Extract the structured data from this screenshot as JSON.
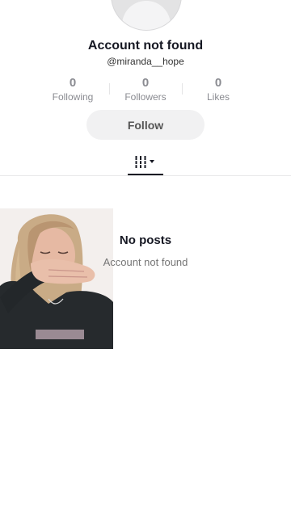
{
  "profile": {
    "name": "Account not found",
    "handle": "@miranda__hope"
  },
  "stats": [
    {
      "value": "0",
      "label": "Following"
    },
    {
      "value": "0",
      "label": "Followers"
    },
    {
      "value": "0",
      "label": "Likes"
    }
  ],
  "actions": {
    "follow_label": "Follow"
  },
  "tabs": {
    "active": "videos-grid-icon"
  },
  "empty_state": {
    "title": "No posts",
    "subtitle": "Account not found"
  },
  "colors": {
    "text_primary": "#161823",
    "text_muted": "#8a8b91",
    "button_bg": "#f1f1f2",
    "background": "#ffffff"
  }
}
